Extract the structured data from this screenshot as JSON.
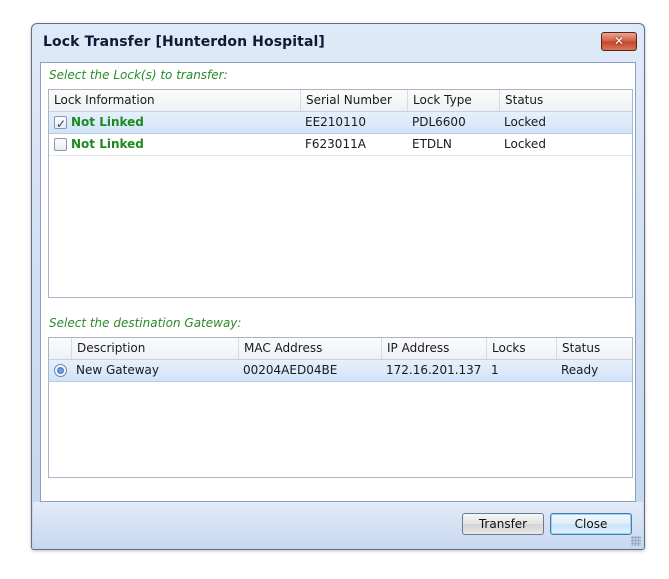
{
  "window": {
    "title": "Lock Transfer [Hunterdon Hospital]",
    "close_glyph": "✕"
  },
  "locks_section": {
    "label": "Select the Lock(s) to transfer:",
    "columns": [
      "Lock Information",
      "Serial Number",
      "Lock Type",
      "Status"
    ],
    "rows": [
      {
        "checked": true,
        "info": "Not Linked",
        "serial": "EE210110",
        "type": "PDL6600",
        "status": "Locked"
      },
      {
        "checked": false,
        "info": "Not Linked",
        "serial": "F623011A",
        "type": "ETDLN",
        "status": "Locked"
      }
    ]
  },
  "gateway_section": {
    "label": "Select the destination Gateway:",
    "columns": [
      "Description",
      "MAC Address",
      "IP Address",
      "Locks",
      "Status"
    ],
    "rows": [
      {
        "selected": true,
        "description": "New Gateway",
        "mac": "00204AED04BE",
        "ip": "172.16.201.137",
        "locks": "1",
        "status": "Ready"
      }
    ]
  },
  "buttons": {
    "transfer": "Transfer",
    "close": "Close"
  },
  "icons": {
    "checkbox_tick": "✓"
  }
}
